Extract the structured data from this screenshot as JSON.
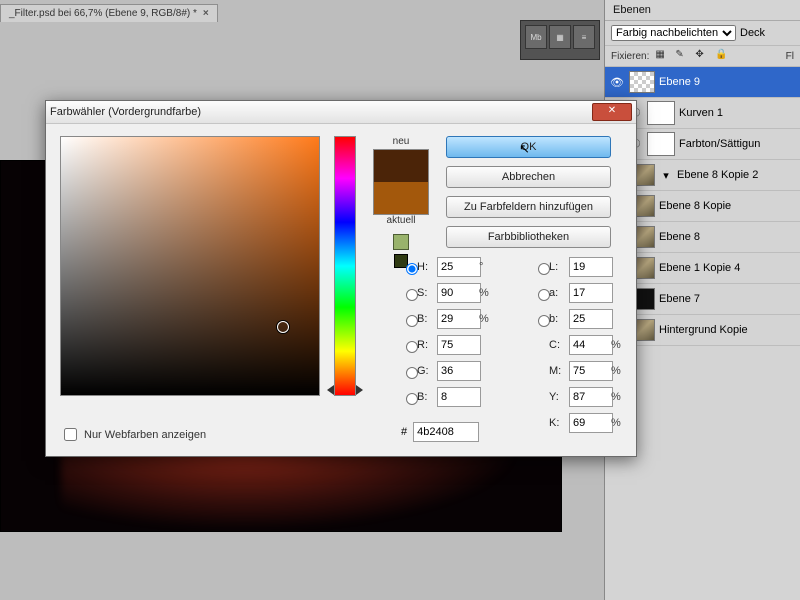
{
  "document_tab": {
    "title": "_Filter.psd bei 66,7% (Ebene 9, RGB/8#) *"
  },
  "layers_panel": {
    "title": "Ebenen",
    "opacity_label": "Deck",
    "blend_mode": "Farbig nachbelichten",
    "lock_label": "Fixieren:",
    "fill_label": "Fl",
    "layers": [
      {
        "name": "Ebene 9",
        "selected": true,
        "thumb": "checker"
      },
      {
        "name": "Kurven 1",
        "has_mask": true,
        "thumb": "white"
      },
      {
        "name": "Farbton/Sättigun",
        "has_mask": true,
        "thumb": "white"
      },
      {
        "name": "Ebene 8 Kopie 2",
        "has_mask": true,
        "caret": true,
        "thumb": "photo"
      },
      {
        "name": "Ebene 8 Kopie",
        "thumb": "photo"
      },
      {
        "name": "Ebene 8",
        "thumb": "photo"
      },
      {
        "name": "Ebene 1 Kopie 4",
        "thumb": "photo"
      },
      {
        "name": "Ebene 7",
        "thumb": "dark"
      },
      {
        "name": "Hintergrund Kopie",
        "thumb": "photo"
      }
    ]
  },
  "color_picker": {
    "title": "Farbwähler (Vordergrundfarbe)",
    "new_label": "neu",
    "current_label": "aktuell",
    "new_color": "#4b2408",
    "current_color": "#a3580c",
    "buttons": {
      "ok": "OK",
      "cancel": "Abbrechen",
      "add_swatches": "Zu Farbfeldern hinzufügen",
      "libraries": "Farbbibliotheken"
    },
    "webonly_label": "Nur Webfarben anzeigen",
    "hex_label": "#",
    "hex_value": "4b2408",
    "H": {
      "label": "H:",
      "value": "25",
      "unit": "°"
    },
    "S": {
      "label": "S:",
      "value": "90",
      "unit": "%"
    },
    "Bv": {
      "label": "B:",
      "value": "29",
      "unit": "%"
    },
    "R": {
      "label": "R:",
      "value": "75",
      "unit": ""
    },
    "G": {
      "label": "G:",
      "value": "36",
      "unit": ""
    },
    "Bc": {
      "label": "B:",
      "value": "8",
      "unit": ""
    },
    "L": {
      "label": "L:",
      "value": "19",
      "unit": ""
    },
    "a": {
      "label": "a:",
      "value": "17",
      "unit": ""
    },
    "b": {
      "label": "b:",
      "value": "25",
      "unit": ""
    },
    "C": {
      "label": "C:",
      "value": "44",
      "unit": "%"
    },
    "M": {
      "label": "M:",
      "value": "75",
      "unit": "%"
    },
    "Y": {
      "label": "Y:",
      "value": "87",
      "unit": "%"
    },
    "K": {
      "label": "K:",
      "value": "69",
      "unit": "%"
    }
  }
}
